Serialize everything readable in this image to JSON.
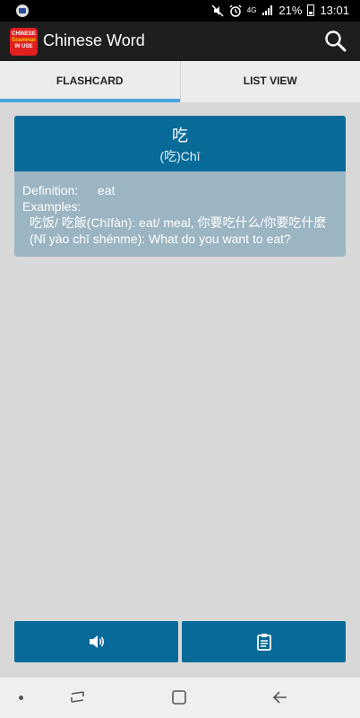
{
  "status_bar": {
    "network": "4G",
    "battery": "21%",
    "time": "13:01",
    "icons": [
      "app-notification-icon",
      "mute-icon",
      "alarm-icon",
      "signal-icon",
      "battery-icon"
    ]
  },
  "app_bar": {
    "logo_lines": [
      "CHINESE",
      "Grammar",
      "IN USE"
    ],
    "title": "Chinese Word",
    "search_icon": "search-icon"
  },
  "tabs": [
    {
      "label": "FLASHCARD",
      "active": true
    },
    {
      "label": "LIST VIEW",
      "active": false
    }
  ],
  "card": {
    "hanzi": "吃",
    "pinyin": "(吃)Chī",
    "definition_label": "Definition:",
    "definition_value": "eat",
    "examples_label": "Examples:",
    "examples_text": "吃饭/ 吃飯(Chīfàn): eat/ meal, 你要吃什么/你要吃什麼(Nǐ yào chī shénme): What do you want to eat?"
  },
  "actions": [
    {
      "icon": "speaker-icon"
    },
    {
      "icon": "clipboard-icon"
    }
  ],
  "colors": {
    "card_header": "#076a98",
    "card_body": "#9cb5c3",
    "tab_indicator": "#4aa3df",
    "background": "#d8d8d8"
  }
}
